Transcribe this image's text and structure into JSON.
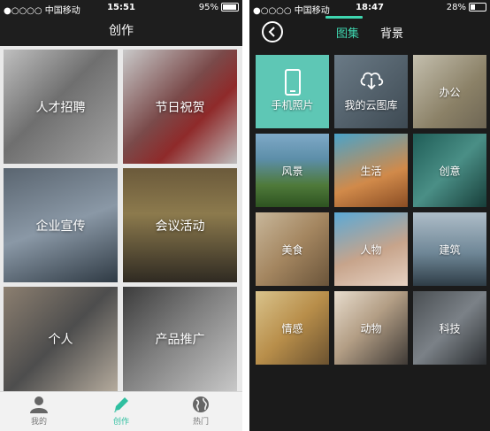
{
  "left": {
    "status": {
      "carrier": "●○○○○ 中国移动",
      "time": "15:51",
      "battery": "95%",
      "battery_level": 0.95
    },
    "title": "创作",
    "tiles": [
      {
        "label": "人才招聘"
      },
      {
        "label": "节日祝贺"
      },
      {
        "label": "企业宣传"
      },
      {
        "label": "会议活动"
      },
      {
        "label": "个人"
      },
      {
        "label": "产品推广"
      }
    ],
    "tabbar": {
      "mine": "我的",
      "create": "创作",
      "hot": "热门"
    },
    "colors": {
      "accent": "#2fbfa0"
    }
  },
  "right": {
    "status": {
      "carrier": "●○○○○ 中国移动",
      "time": "18:47",
      "battery": "28%",
      "battery_level": 0.28
    },
    "tabs": {
      "atlas": "图集",
      "background": "背景"
    },
    "tiles": [
      {
        "label": "手机照片",
        "icon": "phone-icon"
      },
      {
        "label": "我的云图库",
        "icon": "cloud-download-icon"
      },
      {
        "label": "办公"
      },
      {
        "label": "风景"
      },
      {
        "label": "生活"
      },
      {
        "label": "创意"
      },
      {
        "label": "美食"
      },
      {
        "label": "人物"
      },
      {
        "label": "建筑"
      },
      {
        "label": "情感"
      },
      {
        "label": "动物"
      },
      {
        "label": "科技"
      }
    ],
    "colors": {
      "accent": "#3fd6b0"
    }
  }
}
